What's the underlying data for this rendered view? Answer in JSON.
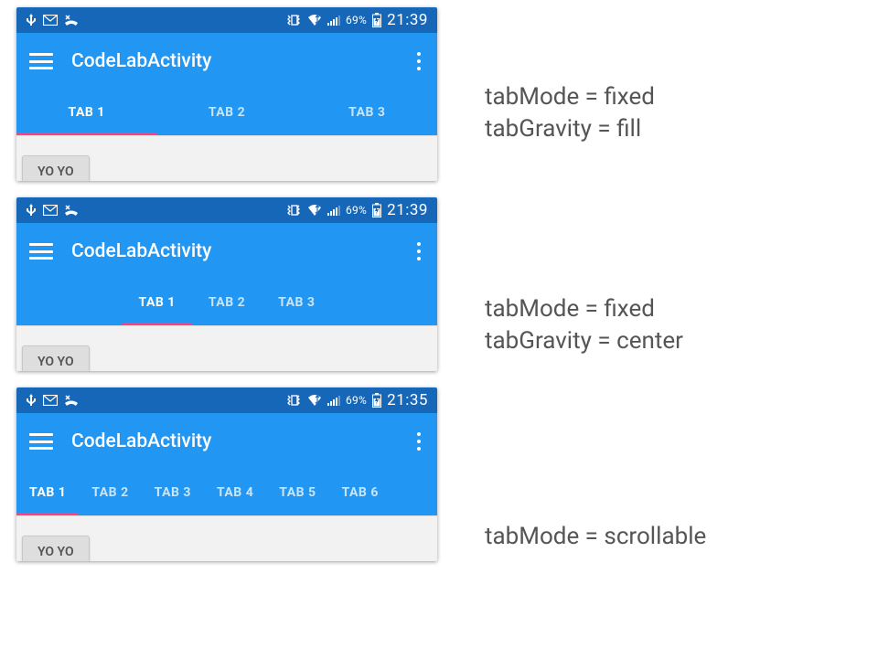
{
  "colors": {
    "status_bg": "#1767b8",
    "toolbar_bg": "#2196f3",
    "accent": "#ff4081"
  },
  "screens": [
    {
      "statusbar": {
        "battery_pct": "69%",
        "clock": "21:39"
      },
      "toolbar": {
        "title": "CodeLabActivity"
      },
      "tabs": {
        "mode": "fill",
        "items": [
          "TAB 1",
          "TAB 2",
          "TAB 3"
        ],
        "active_index": 0
      },
      "content": {
        "button_label": "YO YO"
      },
      "caption_line1": "tabMode = fixed",
      "caption_line2": "tabGravity = fill"
    },
    {
      "statusbar": {
        "battery_pct": "69%",
        "clock": "21:39"
      },
      "toolbar": {
        "title": "CodeLabActivity"
      },
      "tabs": {
        "mode": "center",
        "items": [
          "TAB 1",
          "TAB 2",
          "TAB 3"
        ],
        "active_index": 0
      },
      "content": {
        "button_label": "YO YO"
      },
      "caption_line1": "tabMode = fixed",
      "caption_line2": "tabGravity = center"
    },
    {
      "statusbar": {
        "battery_pct": "69%",
        "clock": "21:35"
      },
      "toolbar": {
        "title": "CodeLabActivity"
      },
      "tabs": {
        "mode": "scrollable",
        "items": [
          "TAB 1",
          "TAB 2",
          "TAB 3",
          "TAB 4",
          "TAB 5",
          "TAB 6"
        ],
        "active_index": 0
      },
      "content": {
        "button_label": "YO YO"
      },
      "caption_line1": "tabMode = scrollable",
      "caption_line2": ""
    }
  ]
}
